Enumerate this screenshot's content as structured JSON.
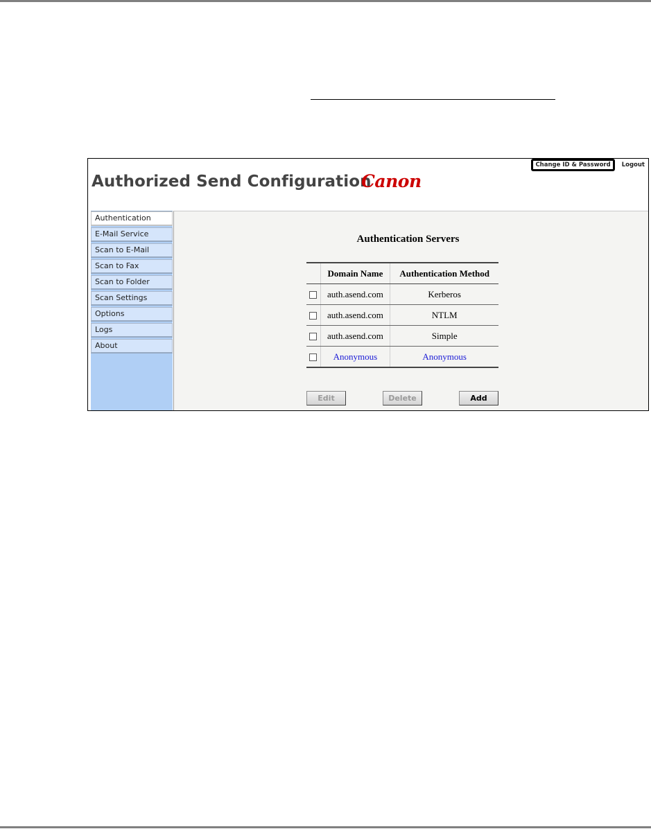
{
  "app": {
    "title": "Authorized Send Configuration",
    "brand": "Canon",
    "change_id_label": "Change ID & Password",
    "logout_label": "Logout"
  },
  "sidebar": {
    "items": [
      {
        "label": "Authentication"
      },
      {
        "label": "E-Mail Service"
      },
      {
        "label": "Scan to E-Mail"
      },
      {
        "label": "Scan to Fax"
      },
      {
        "label": "Scan to Folder"
      },
      {
        "label": "Scan Settings"
      },
      {
        "label": "Options"
      },
      {
        "label": "Logs"
      },
      {
        "label": "About"
      }
    ],
    "active_index": 0
  },
  "main": {
    "section_title": "Authentication Servers",
    "table": {
      "columns": [
        "Domain Name",
        "Authentication Method"
      ],
      "rows": [
        {
          "domain": "auth.asend.com",
          "method": "Kerberos",
          "checked": false
        },
        {
          "domain": "auth.asend.com",
          "method": "NTLM",
          "checked": false
        },
        {
          "domain": "auth.asend.com",
          "method": "Simple",
          "checked": false
        },
        {
          "domain": "Anonymous",
          "method": "Anonymous",
          "checked": false
        }
      ]
    },
    "buttons": {
      "edit": "Edit",
      "delete": "Delete",
      "add": "Add"
    }
  },
  "colors": {
    "brand_red": "#cc0000",
    "sidebar_blue": "#b0cff5",
    "link_blue": "#1a1ad6"
  }
}
